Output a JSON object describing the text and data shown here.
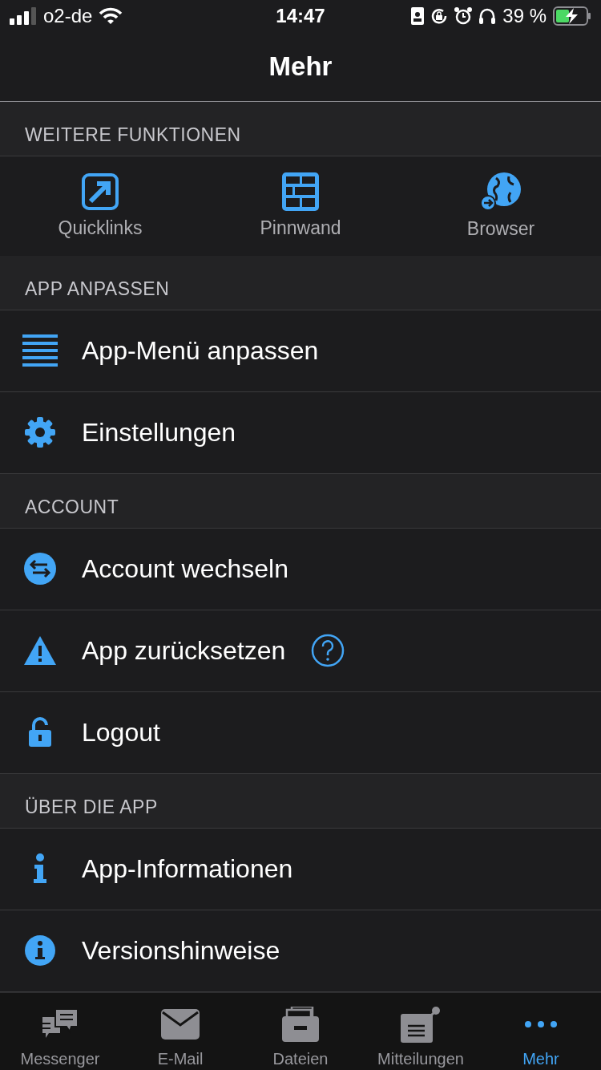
{
  "status_bar": {
    "carrier": "o2-de",
    "time": "14:47",
    "battery": "39 %"
  },
  "nav_bar": {
    "title": "Mehr"
  },
  "sections": [
    {
      "title": "WEITERE FUNKTIONEN",
      "kind": "tiles",
      "items": [
        {
          "label": "Quicklinks"
        },
        {
          "label": "Pinnwand"
        },
        {
          "label": "Browser"
        }
      ]
    },
    {
      "title": "APP ANPASSEN",
      "kind": "rows",
      "items": [
        {
          "label": "App-Menü anpassen",
          "help": false
        },
        {
          "label": "Einstellungen",
          "help": false
        }
      ]
    },
    {
      "title": "ACCOUNT",
      "kind": "rows",
      "items": [
        {
          "label": "Account wechseln",
          "help": false
        },
        {
          "label": "App zurücksetzen",
          "help": true
        },
        {
          "label": "Logout",
          "help": false
        }
      ]
    },
    {
      "title": "ÜBER DIE APP",
      "kind": "rows",
      "items": [
        {
          "label": "App-Informationen",
          "help": false
        },
        {
          "label": "Versionshinweise",
          "help": false
        }
      ]
    }
  ],
  "tab_bar": [
    {
      "label": "Messenger",
      "selected": false
    },
    {
      "label": "E-Mail",
      "selected": false
    },
    {
      "label": "Dateien",
      "selected": false
    },
    {
      "label": "Mitteilungen",
      "selected": false
    },
    {
      "label": "Mehr",
      "selected": true
    }
  ]
}
